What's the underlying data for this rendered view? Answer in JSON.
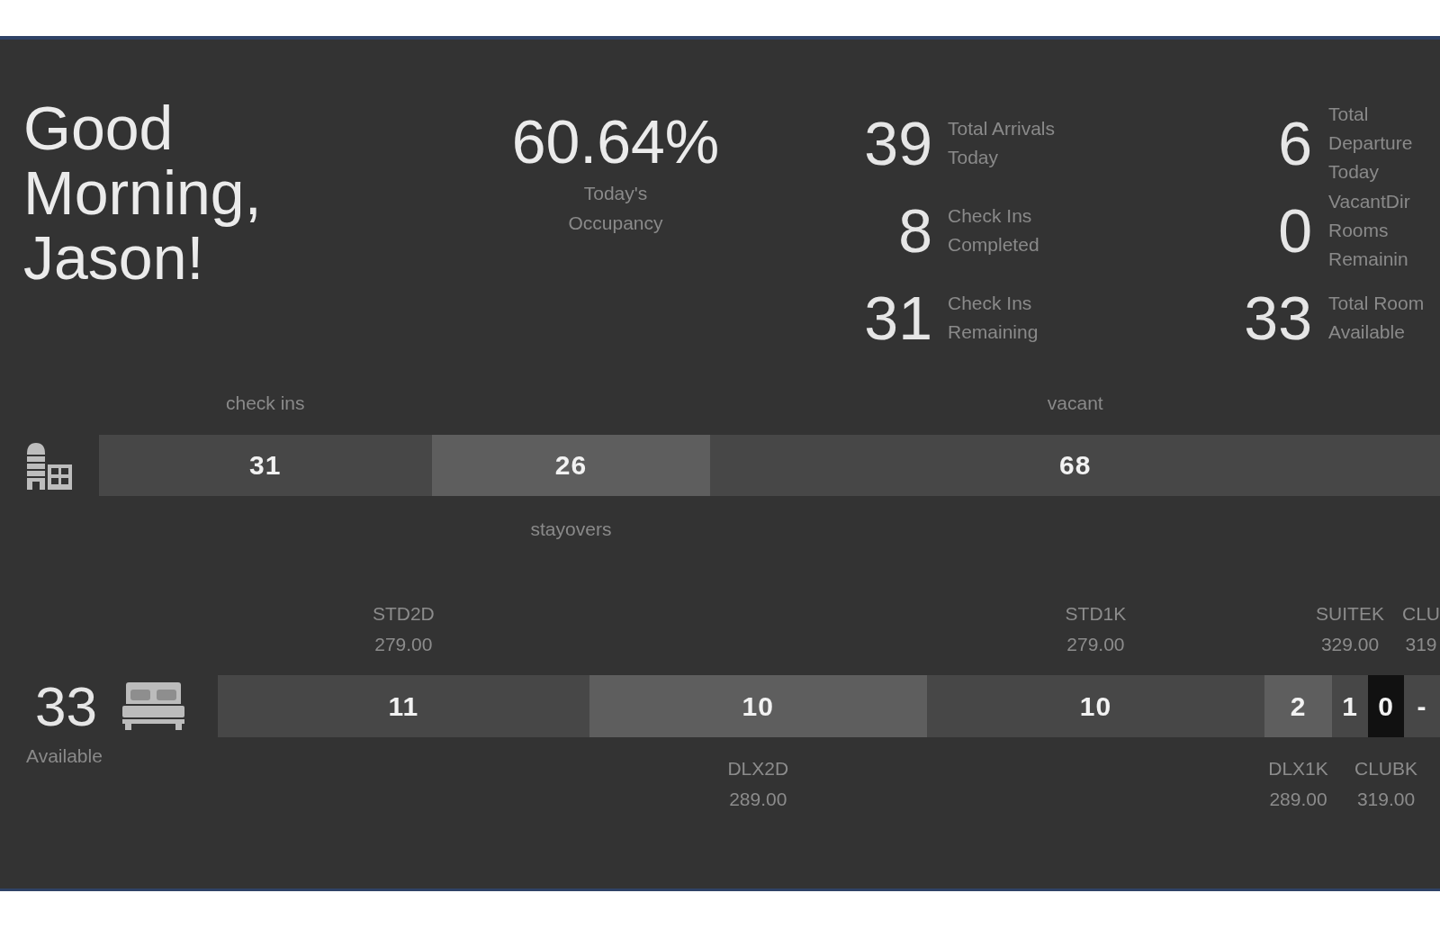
{
  "greeting": "Good Morning, Jason!",
  "occupancy": {
    "value": "60.64%",
    "label": "Today's Occupancy"
  },
  "stat_columns": [
    {
      "items": [
        {
          "value": "39",
          "label": "Total Arrivals Today"
        },
        {
          "value": "8",
          "label": "Check Ins Completed"
        },
        {
          "value": "31",
          "label": "Check Ins Remaining"
        }
      ]
    },
    {
      "items": [
        {
          "value": "6",
          "label": "Total Departure Today"
        },
        {
          "value": "0",
          "label": "VacantDir Rooms Remainin"
        },
        {
          "value": "33",
          "label": "Total Room Available"
        }
      ]
    }
  ],
  "occupancy_bar": {
    "segments": [
      {
        "label": "check ins",
        "value": "31",
        "color": "#474747"
      },
      {
        "label": "stayovers",
        "value": "26",
        "color": "#5e5e5e"
      },
      {
        "label": "vacant",
        "value": "68",
        "color": "#474747"
      }
    ]
  },
  "room_availability": {
    "value": "33",
    "label": "Available",
    "segments": [
      {
        "code": "STD2D",
        "rate": "279.00",
        "value": "11",
        "color": "#474747"
      },
      {
        "code": "DLX2D",
        "rate": "289.00",
        "value": "10",
        "color": "#5e5e5e"
      },
      {
        "code": "STD1K",
        "rate": "279.00",
        "value": "10",
        "color": "#474747"
      },
      {
        "code": "DLX1K",
        "rate": "289.00",
        "value": "2",
        "color": "#5e5e5e"
      },
      {
        "code": "SUITEK",
        "rate": "329.00",
        "value": "1",
        "color": "#474747"
      },
      {
        "code": "CLUBK",
        "rate": "319.00",
        "value": "0",
        "color": "#111111"
      },
      {
        "code": "CLU",
        "rate": "319",
        "value": "-",
        "color": "#474747"
      }
    ]
  }
}
